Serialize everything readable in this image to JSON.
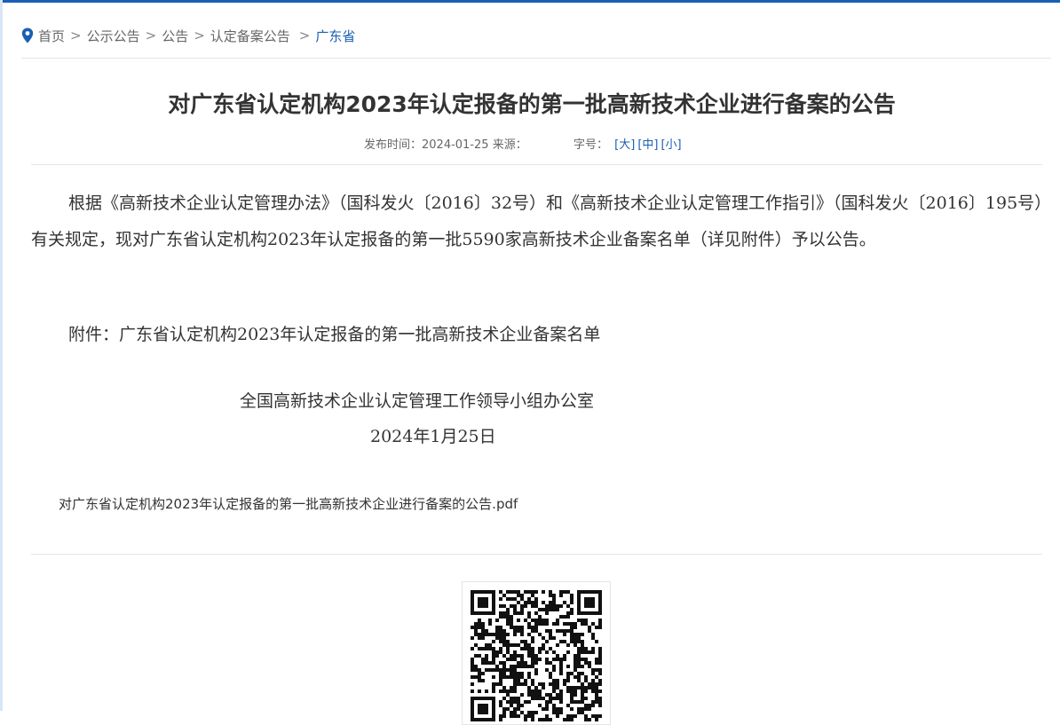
{
  "breadcrumb": {
    "items": [
      "首页",
      "公示公告",
      "公告",
      "认定备案公告"
    ],
    "separator": ">",
    "current": "广东省"
  },
  "article": {
    "title": "对广东省认定机构2023年认定报备的第一批高新技术企业进行备案的公告",
    "meta": {
      "publish_label": "发布时间：",
      "publish_date": "2024-01-25",
      "source_label": "来源：",
      "fontsize_label": "字号：",
      "size_large": "[大]",
      "size_medium": "[中]",
      "size_small": "[小]"
    },
    "paragraph1": "根据《高新技术企业认定管理办法》（国科发火〔2016〕32号）和《高新技术企业认定管理工作指引》（国科发火〔2016〕195号）有关规定，现对广东省认定机构2023年认定报备的第一批5590家高新技术企业备案名单（详见附件）予以公告。",
    "paragraph2": "附件：广东省认定机构2023年认定报备的第一批高新技术企业备案名单",
    "signature_org": "全国高新技术企业认定管理工作领导小组办公室",
    "signature_date": "2024年1月25日",
    "attachment_link": "对广东省认定机构2023年认定报备的第一批高新技术企业进行备案的公告.pdf"
  },
  "colors": {
    "accent": "#1a5fb4",
    "text": "#333333",
    "muted": "#666666",
    "divider": "#e5e5e5"
  },
  "icons": {
    "breadcrumb": "location-pin-icon",
    "qr": "qr-code-icon"
  }
}
